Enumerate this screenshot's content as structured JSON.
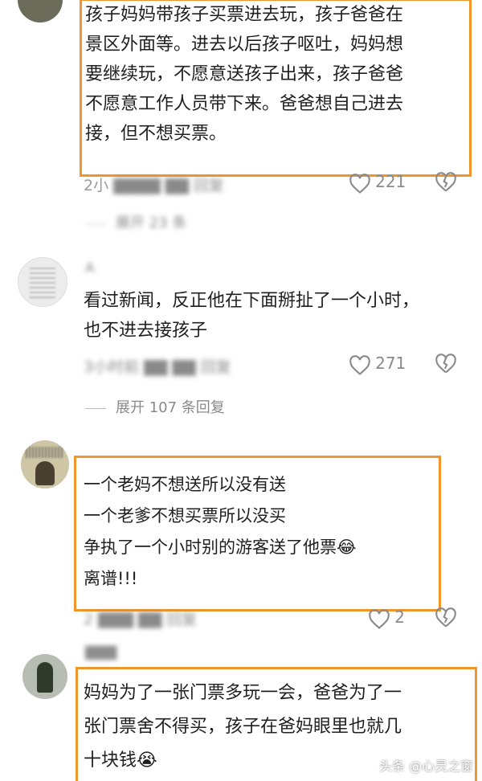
{
  "comments": [
    {
      "avatar_icon": "user-avatar",
      "text": "孩子妈妈带孩子买票进去玩，孩子爸爸在景区外面等。进去以后孩子呕吐，妈妈想要继续玩，不愿意送孩子出来，孩子爸爸不愿意工作人员带下来。爸爸想自己进去接，但不想买票。",
      "lines": [
        "孩子妈妈带孩子买票进去玩，孩子爸爸在",
        "景区外面等。进去以后孩子呕吐，妈妈想",
        "要继续玩，不愿意送孩子出来，孩子爸爸",
        "不愿意工作人员带下来。爸爸想自己进去",
        "接，但不想买票。"
      ],
      "time": "2小",
      "reply": "回复",
      "likes": "221",
      "expand": "展开 23 条"
    },
    {
      "avatar_icon": "user-avatar",
      "name": "A",
      "lines": [
        "看过新闻，反正他在下面掰扯了一个小时，",
        "也不进去接孩子"
      ],
      "time": "3小时前",
      "reply": "回复",
      "likes": "271",
      "expand": "展开 107 条回复"
    },
    {
      "avatar_icon": "user-avatar",
      "lines": [
        "一个老妈不想送所以没有送",
        "一个老爹不想买票所以没买",
        "争执了一个小时别的游客送了他票",
        "离谱!!!"
      ],
      "emoji": "😂",
      "time": "2",
      "reply": "回复",
      "likes": "2"
    },
    {
      "avatar_icon": "user-avatar",
      "lines": [
        "妈妈为了一张门票多玩一会，爸爸为了一",
        "张门票舍不得买，孩子在爸妈眼里也就几",
        "十块钱"
      ],
      "emoji": "😭"
    }
  ],
  "watermark": "头条 @心灵之窗",
  "colors": {
    "highlight": "#f0952a",
    "meta": "#9a9a9a"
  }
}
